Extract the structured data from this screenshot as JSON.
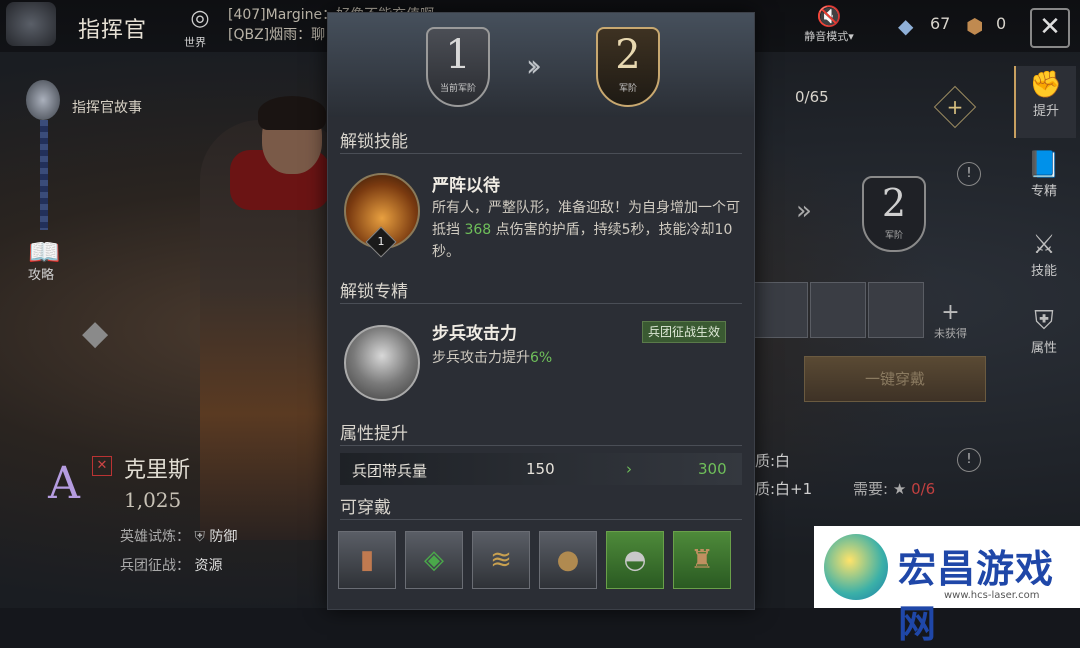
{
  "topbar": {
    "title": "指挥官",
    "world_label": "世界",
    "chat_lines": [
      "[407]Margine：好像不能充值啊",
      "[QBZ]烟雨：聊"
    ],
    "mute_label": "静音模式▾",
    "resource_1": "67",
    "resource_2": "0"
  },
  "left": {
    "story_label": "指挥官故事",
    "guide_label": "攻略",
    "hero_rank": "A",
    "hero_name": "克里斯",
    "hero_power": "1,025",
    "trial_label": "英雄试炼：",
    "trial_value": "防御",
    "campaign_label": "兵团征战：",
    "campaign_value": "资源"
  },
  "right": {
    "tabs": [
      {
        "label": "提升",
        "icon": "fist-icon"
      },
      {
        "label": "专精",
        "icon": "book-icon"
      },
      {
        "label": "技能",
        "icon": "sword-icon"
      },
      {
        "label": "属性",
        "icon": "shield-icon"
      }
    ],
    "progress": "0/65",
    "rank_number": "2",
    "rank_sub": "军阶",
    "unequipped_label": "未获得",
    "one_key_equip": "一键穿戴",
    "quality_1": "品质:白",
    "quality_2": "品质:白+1",
    "need_label": "需要:",
    "need_value": "0/6"
  },
  "modal": {
    "current_rank": "1",
    "current_rank_label": "当前军阶",
    "next_rank": "2",
    "next_rank_label": "军阶",
    "unlock_skill_title": "解锁技能",
    "skill": {
      "level": "1",
      "name": "严阵以待",
      "desc_1": "所有人，严整队形，准备迎敌！为自身增加一个可抵挡 ",
      "desc_value": "368",
      "desc_2": " 点伤害的护盾，持续5秒，技能冷却10秒。"
    },
    "unlock_spec_title": "解锁专精",
    "spec": {
      "name": "步兵攻击力",
      "tag": "兵团征战生效",
      "desc_1": "步兵攻击力提升",
      "desc_value": "6%"
    },
    "attr_title": "属性提升",
    "attr": {
      "name": "兵团带兵量",
      "from": "150",
      "arrow": "›",
      "to": "300"
    },
    "wearable_title": "可穿戴",
    "wearables": [
      "bracer-icon",
      "amulet-icon",
      "sandals-icon",
      "round-shield-icon",
      "helmet-icon",
      "armor-icon"
    ]
  },
  "watermark": {
    "text": "宏昌游戏网",
    "url": "www.hcs-laser.com"
  },
  "colors": {
    "highlight": "#6fbf5a",
    "panel": "#2b2e35",
    "gold": "#c8a870"
  }
}
